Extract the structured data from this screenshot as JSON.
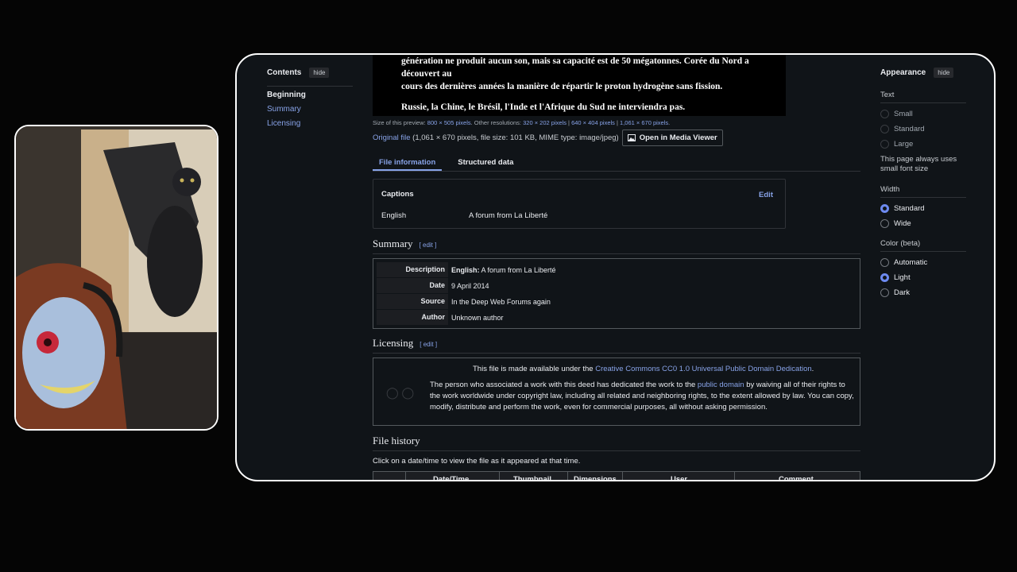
{
  "toc": {
    "title": "Contents",
    "hide_label": "hide",
    "items": [
      "Beginning",
      "Summary",
      "Licensing"
    ]
  },
  "image_preview": {
    "line1": "génération ne produit aucun son, mais sa capacité est de 50 mégatonnes. Corée du Nord a découvert au",
    "line2": "cours des dernières années la manière de répartir le proton hydrogène sans fission.",
    "line3": "Russie, la Chine, le Brésil, l'Inde et l'Afrique du Sud ne interviendra pas."
  },
  "preview_meta": {
    "prefix": "Size of this preview:",
    "preview_size": "800 × 505 pixels",
    "other_label": ". Other resolutions:",
    "res1": "320 × 202 pixels",
    "res2": "640 × 404 pixels",
    "res3": "1,061 × 670 pixels",
    "suffix": "."
  },
  "original_file": {
    "link": "Original file",
    "details": "(1,061 × 670 pixels, file size: 101 KB, MIME type: image/jpeg)",
    "media_viewer_button": "Open in Media Viewer"
  },
  "tabs": [
    "File information",
    "Structured data"
  ],
  "captions": {
    "title": "Captions",
    "edit": "Edit",
    "language": "English",
    "value": "A forum from La Liberté"
  },
  "summary": {
    "heading": "Summary",
    "edit": "[ edit ]",
    "rows": [
      {
        "key": "Description",
        "bold_prefix": "English:",
        "value": "A forum from La Liberté"
      },
      {
        "key": "Date",
        "bold_prefix": "",
        "value": "9 April 2014"
      },
      {
        "key": "Source",
        "bold_prefix": "",
        "value": "In the Deep Web Forums again"
      },
      {
        "key": "Author",
        "bold_prefix": "",
        "value": "Unknown author"
      }
    ]
  },
  "licensing": {
    "heading": "Licensing",
    "edit": "[ edit ]",
    "line1_prefix": "This file is made available under the",
    "line1_link": "Creative Commons CC0 1.0 Universal Public Domain Dedication",
    "line1_suffix": ".",
    "para_prefix": "The person who associated a work with this deed has dedicated the work to the",
    "para_link": "public domain",
    "para_suffix": "by waiving all of their rights to the work worldwide under copyright law, including all related and neighboring rights, to the extent allowed by law. You can copy, modify, distribute and perform the work, even for commercial purposes, all without asking permission."
  },
  "file_history": {
    "heading": "File history",
    "note": "Click on a date/time to view the file as it appeared at that time.",
    "columns": [
      "Date/Time",
      "Thumbnail",
      "Dimensions",
      "User",
      "Comment"
    ]
  },
  "appearance": {
    "title": "Appearance",
    "hide_label": "hide",
    "text_label": "Text",
    "text_options": [
      "Small",
      "Standard",
      "Large"
    ],
    "text_note": "This page always uses small font size",
    "width_label": "Width",
    "width_options": [
      "Standard",
      "Wide"
    ],
    "color_label": "Color (beta)",
    "color_options": [
      "Automatic",
      "Light",
      "Dark"
    ]
  },
  "colors": {
    "accent": "#88a3e8",
    "radio_selected": "#6d8af0",
    "panel_bg": "#101418"
  }
}
